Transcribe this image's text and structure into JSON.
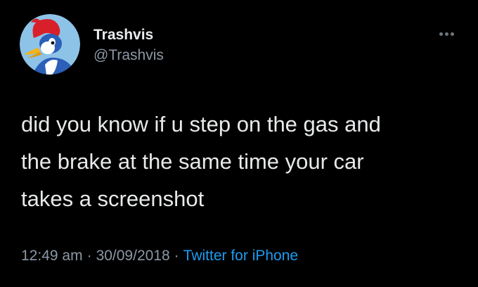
{
  "author": {
    "name": "Trashvis",
    "handle": "@Trashvis",
    "avatar_icon": "woody-woodpecker-avatar-icon"
  },
  "menu": {
    "icon": "more-options-icon"
  },
  "tweet": {
    "lines": [
      "did you know if u step on the gas and",
      "the brake at the same time your car",
      "takes a screenshot"
    ]
  },
  "meta": {
    "time": "12:49 am",
    "separator": "·",
    "date": "30/09/2018",
    "source": "Twitter for iPhone"
  },
  "colors": {
    "background": "#000000",
    "text": "#e7e9ea",
    "secondary": "#8b98a5",
    "link": "#1d9bf0"
  }
}
